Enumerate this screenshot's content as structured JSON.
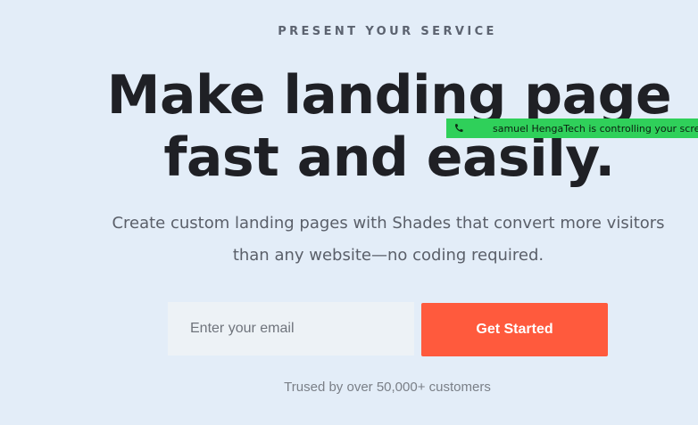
{
  "hero": {
    "eyebrow": "PRESENT YOUR SERVICE",
    "headline_line_1": "Make landing page",
    "headline_line_2": "fast and easily.",
    "subtitle_line_1": "Create custom landing pages with Shades that convert more visitors",
    "subtitle_line_2": "than any website—no coding required."
  },
  "signup": {
    "email_placeholder": "Enter your email",
    "cta_label": "Get Started"
  },
  "trust": {
    "text": "Trused by over 50,000+ customers"
  },
  "notification": {
    "icon": "phone-icon",
    "text": "samuel HengaTech is controlling your scre"
  },
  "colors": {
    "background": "#e3edf8",
    "cta": "#ff5a3d",
    "notification": "#2fd05a"
  }
}
